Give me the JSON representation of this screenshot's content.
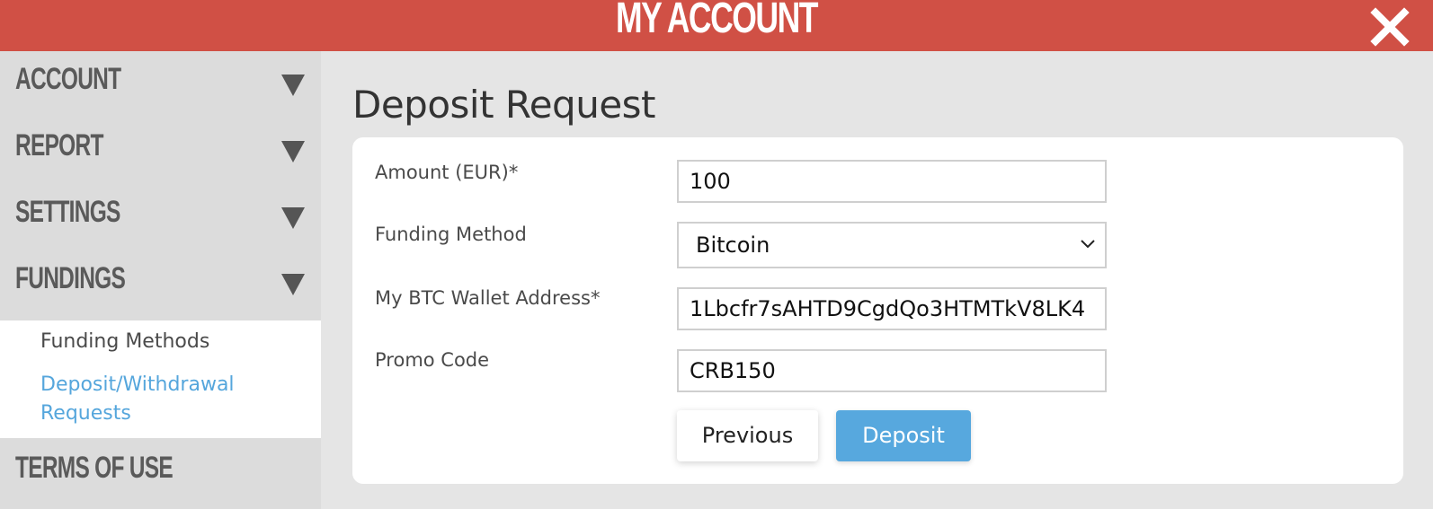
{
  "header": {
    "title": "MY ACCOUNT",
    "close_icon": "close-icon",
    "color": "#d05045"
  },
  "sidebar": {
    "sections": [
      {
        "label": "ACCOUNT",
        "icon": "triangle-down-icon"
      },
      {
        "label": "REPORT",
        "icon": "triangle-down-icon"
      },
      {
        "label": "SETTINGS",
        "icon": "triangle-down-icon"
      },
      {
        "label": "FUNDINGS",
        "icon": "triangle-down-icon"
      }
    ],
    "fundings_items": [
      {
        "label": "Funding Methods"
      },
      {
        "label": "Deposit/Withdrawal Requests",
        "active": true
      }
    ],
    "terms_label": "TERMS OF USE"
  },
  "main": {
    "title": "Deposit Request",
    "fields": {
      "amount": {
        "label": "Amount (EUR)*",
        "value": "100"
      },
      "funding_method": {
        "label": "Funding Method",
        "value": "Bitcoin"
      },
      "wallet": {
        "label": "My BTC Wallet Address*",
        "value": "1Lbcfr7sAHTD9CgdQo3HTMTkV8LK4"
      },
      "promo": {
        "label": "Promo Code",
        "value": "CRB150"
      }
    },
    "buttons": {
      "previous": "Previous",
      "deposit": "Deposit"
    }
  },
  "colors": {
    "accent": "#57a8de",
    "link": "#55a6dc",
    "sidebar_bg": "#dcdcdc"
  }
}
